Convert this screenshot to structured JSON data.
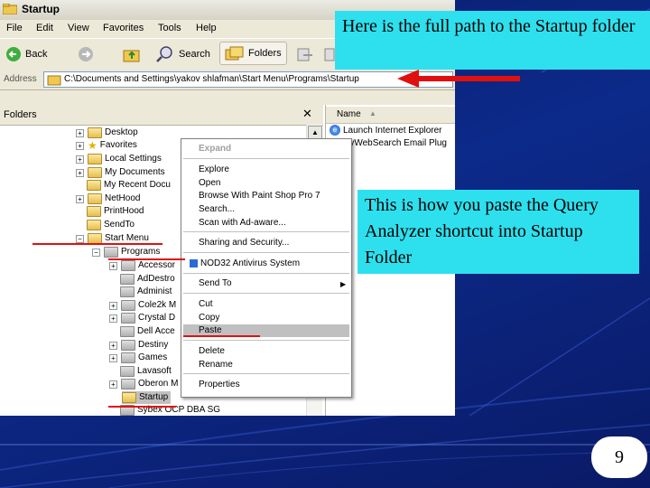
{
  "window": {
    "title": "Startup",
    "menu": [
      "File",
      "Edit",
      "View",
      "Favorites",
      "Tools",
      "Help"
    ],
    "toolbar": {
      "back": "Back",
      "search": "Search",
      "folders": "Folders"
    },
    "address_label": "Address",
    "address_value": "C:\\Documents and Settings\\yakov shlafman\\Start Menu\\Programs\\Startup"
  },
  "folders_pane": {
    "header": "Folders",
    "close": "✕",
    "items": [
      {
        "label": "Desktop"
      },
      {
        "label": "Favorites"
      },
      {
        "label": "Local Settings"
      },
      {
        "label": "My Documents"
      },
      {
        "label": "My Recent Docu"
      },
      {
        "label": "NetHood"
      },
      {
        "label": "PrintHood"
      },
      {
        "label": "SendTo"
      },
      {
        "label": "Start Menu"
      },
      {
        "label": "Programs"
      },
      {
        "label": "Accessor"
      },
      {
        "label": "AdDestro"
      },
      {
        "label": "Administ"
      },
      {
        "label": "Cole2k M"
      },
      {
        "label": "Crystal D"
      },
      {
        "label": "Dell Acce"
      },
      {
        "label": "Destiny"
      },
      {
        "label": "Games"
      },
      {
        "label": "Lavasoft"
      },
      {
        "label": "Oberon M"
      },
      {
        "label": "Startup"
      },
      {
        "label": "Sybex OCP DBA SG"
      }
    ]
  },
  "list_pane": {
    "header": "Name",
    "rows": [
      "Launch Internet Explorer",
      "MyWebSearch Email Plug"
    ]
  },
  "context_menu": {
    "items": [
      "Expand",
      "Explore",
      "Open",
      "Browse With Paint Shop Pro 7",
      "Search...",
      "Scan with Ad-aware...",
      "Sharing and Security...",
      "NOD32 Antivirus System",
      "Send To",
      "Cut",
      "Copy",
      "Paste",
      "Delete",
      "Rename",
      "Properties"
    ],
    "highlighted": "Paste"
  },
  "callouts": {
    "path": "Here is the full path to the Startup folder",
    "paste": "This is how you paste the Query Analyzer shortcut into Startup Folder"
  },
  "page_number": "9",
  "colors": {
    "callout": "#2ee0ee",
    "annotation": "#e01010",
    "slide_bg": "#0b1f6e"
  }
}
